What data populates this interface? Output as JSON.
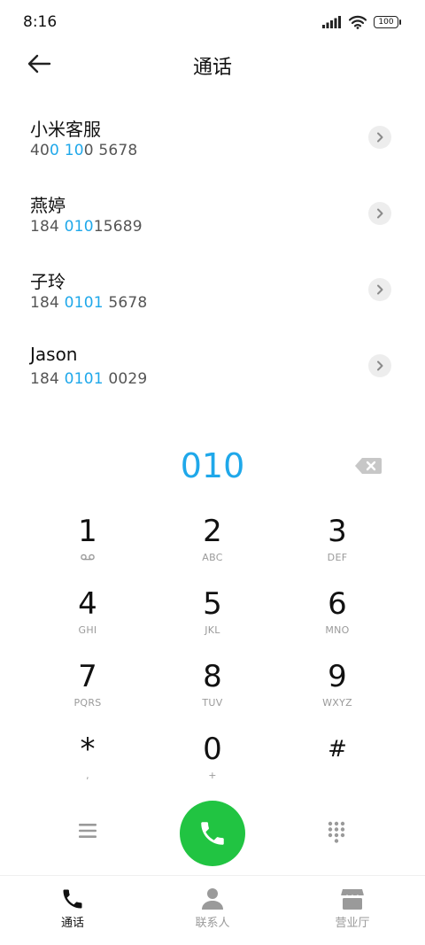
{
  "status_bar": {
    "time": "8:16",
    "battery": "100"
  },
  "header": {
    "title": "通话"
  },
  "contacts": [
    {
      "name": "小米客服",
      "number_parts": [
        "40",
        "0",
        " ",
        "10",
        "0 5678"
      ]
    },
    {
      "name": "燕婷",
      "number_parts": [
        "184 ",
        "010",
        "15689"
      ]
    },
    {
      "name": "子玲",
      "number_parts": [
        "184 ",
        "0101",
        " 5678"
      ]
    },
    {
      "name": "Jason",
      "number_parts": [
        "184 ",
        "0101",
        " 0029"
      ]
    }
  ],
  "dialer": {
    "input": "010"
  },
  "keypad": [
    {
      "digit": "1",
      "letters": ""
    },
    {
      "digit": "2",
      "letters": "ABC"
    },
    {
      "digit": "3",
      "letters": "DEF"
    },
    {
      "digit": "4",
      "letters": "GHI"
    },
    {
      "digit": "5",
      "letters": "JKL"
    },
    {
      "digit": "6",
      "letters": "MNO"
    },
    {
      "digit": "7",
      "letters": "PQRS"
    },
    {
      "digit": "8",
      "letters": "TUV"
    },
    {
      "digit": "9",
      "letters": "WXYZ"
    },
    {
      "digit": "*",
      "letters": ","
    },
    {
      "digit": "0",
      "letters": "+"
    },
    {
      "digit": "#",
      "letters": ""
    }
  ],
  "tabs": [
    {
      "label": "通话",
      "icon": "phone-icon",
      "active": true
    },
    {
      "label": "联系人",
      "icon": "person-icon",
      "active": false
    },
    {
      "label": "营业厅",
      "icon": "store-icon",
      "active": false
    }
  ],
  "colors": {
    "accent": "#1fa8ea",
    "call": "#21c442",
    "inactive": "#9a9a9a"
  }
}
